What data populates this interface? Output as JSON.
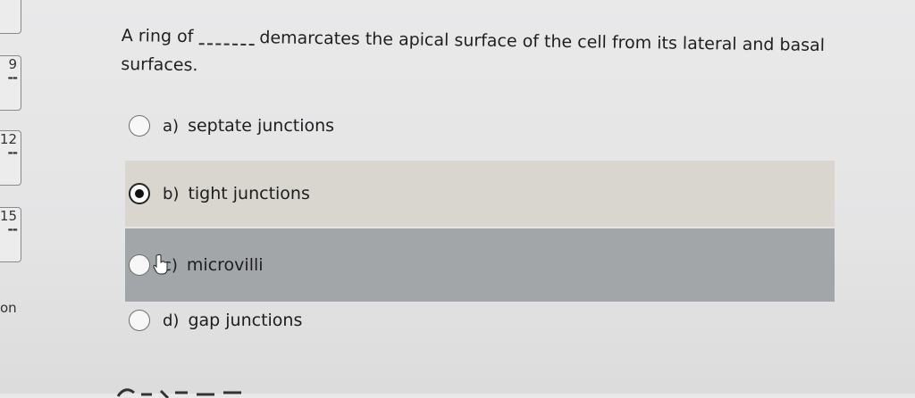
{
  "sidebar": {
    "items": [
      {
        "num": "",
        "dash": ""
      },
      {
        "num": "9",
        "dash": "--"
      },
      {
        "num": "12",
        "dash": "--"
      },
      {
        "num": "15",
        "dash": "--"
      }
    ],
    "label": "on"
  },
  "question": {
    "text_before": "A ring of",
    "text_after": "demarcates the apical surface of the cell from its lateral and basal surfaces."
  },
  "options": [
    {
      "letter": "a)",
      "label": "septate junctions",
      "selected": false
    },
    {
      "letter": "b)",
      "label": "tight junctions",
      "selected": true
    },
    {
      "letter": "c)",
      "label": "microvilli",
      "selected": false
    },
    {
      "letter": "d)",
      "label": "gap junctions",
      "selected": false
    }
  ],
  "colors": {
    "selected_row": "#d9d6d0",
    "hover_row": "#a3a6a8"
  }
}
